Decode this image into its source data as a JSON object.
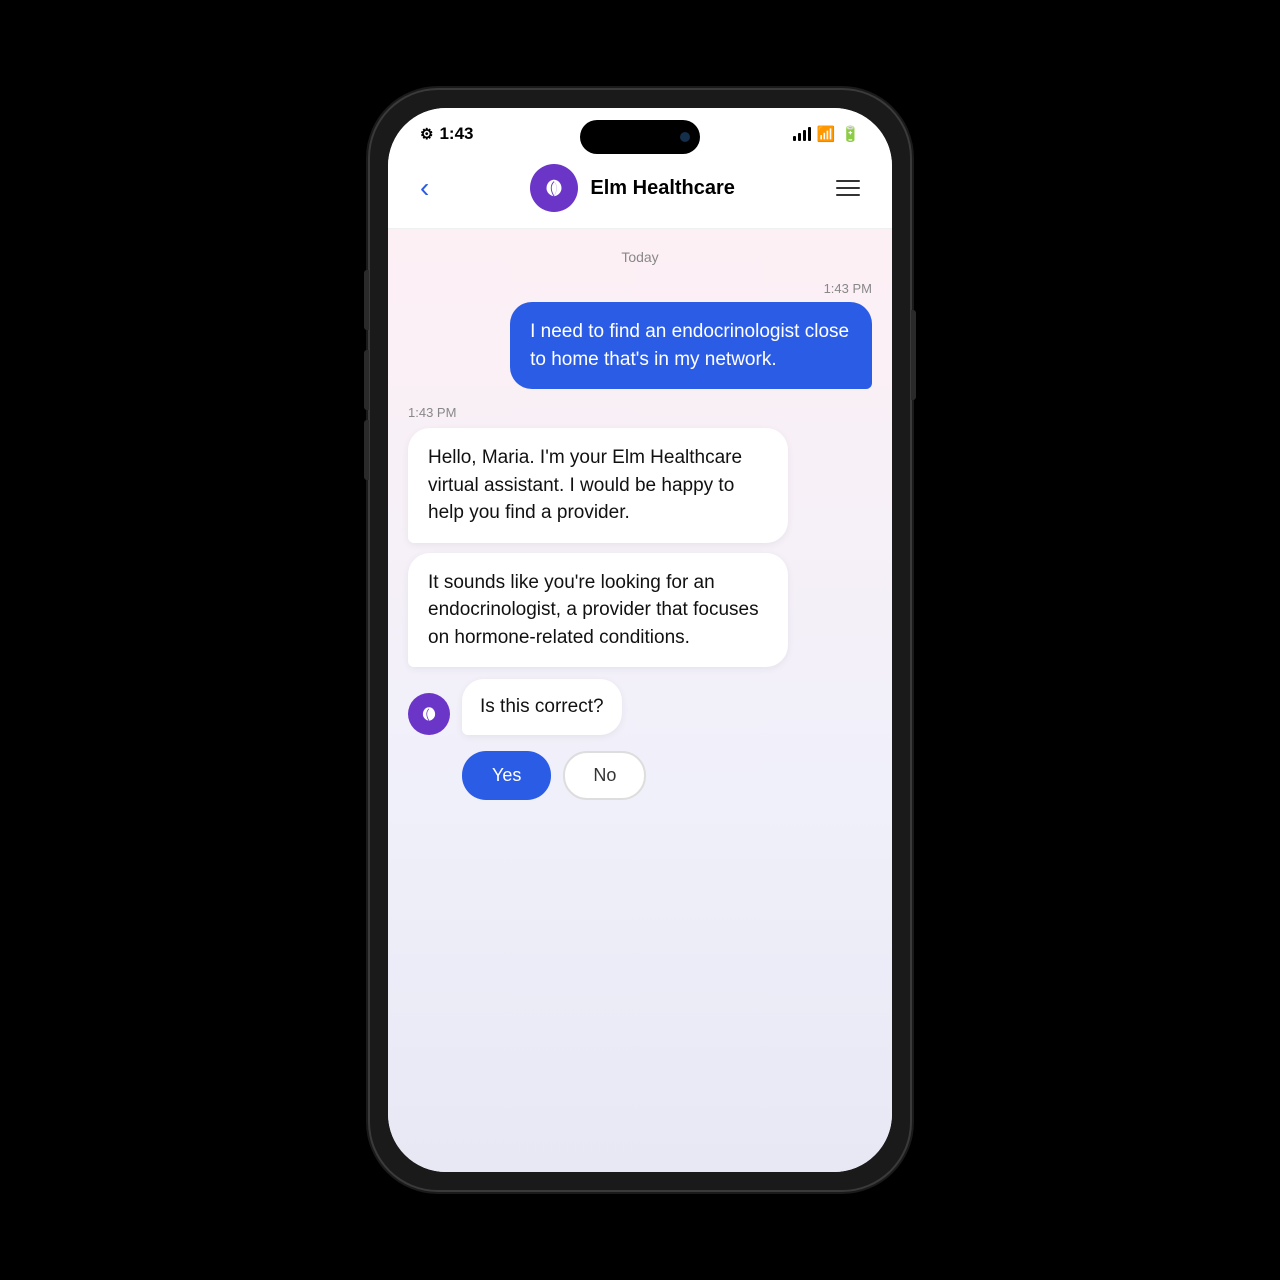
{
  "statusBar": {
    "time": "1:43",
    "gearSymbol": "⚙"
  },
  "header": {
    "backLabel": "‹",
    "title": "Elm Healthcare",
    "menuAriaLabel": "Menu"
  },
  "chat": {
    "dateLabel": "Today",
    "userMessage": {
      "time": "1:43 PM",
      "text": "I need to find an endocrinologist close to home that's in my network."
    },
    "botMessages": [
      {
        "time": "1:43 PM",
        "text": "Hello, Maria. I'm your Elm Healthcare virtual assistant. I would be happy to help you find a provider."
      },
      {
        "text": "It sounds like you're looking for an endocrinologist, a provider that focuses on hormone-related conditions."
      }
    ],
    "botQuestion": "Is this correct?",
    "quickReplies": {
      "yes": "Yes",
      "no": "No"
    }
  },
  "colors": {
    "userBubble": "#2b5ce6",
    "logoBackground": "#6b35c8",
    "backButton": "#2b5ce6"
  }
}
